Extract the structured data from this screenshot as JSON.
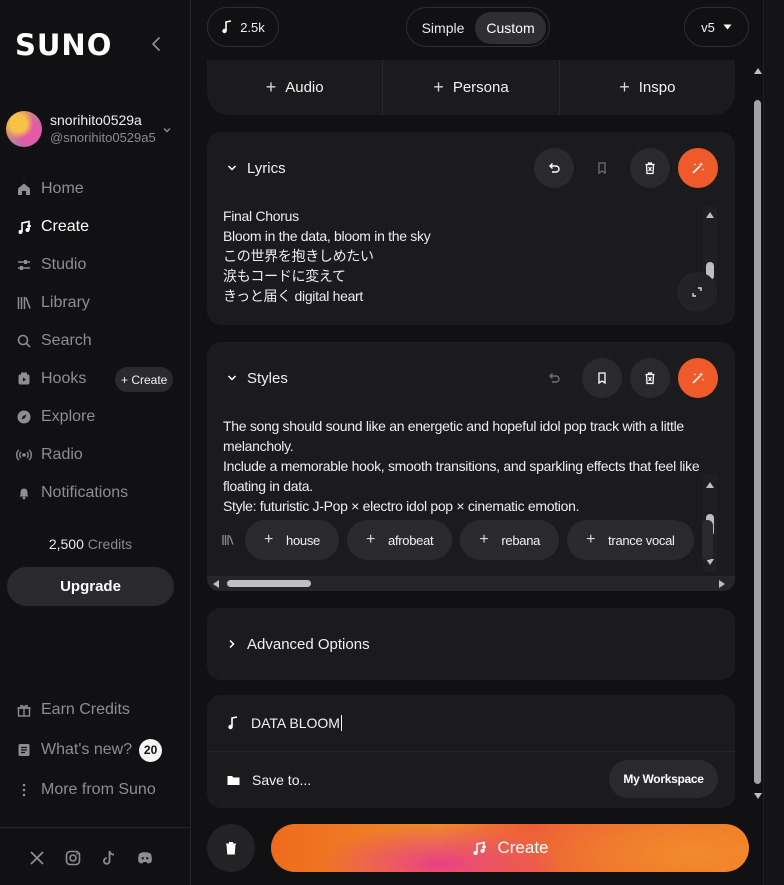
{
  "sidebar": {
    "logo": "SUNO",
    "user": {
      "name": "snorihito0529a",
      "handle": "@snorihito0529a5"
    },
    "nav": [
      {
        "label": "Home",
        "icon": "home-icon"
      },
      {
        "label": "Create",
        "icon": "create-icon",
        "active": true
      },
      {
        "label": "Studio",
        "icon": "studio-icon"
      },
      {
        "label": "Library",
        "icon": "library-icon"
      },
      {
        "label": "Search",
        "icon": "search-icon"
      },
      {
        "label": "Hooks",
        "icon": "hooks-icon"
      },
      {
        "label": "Explore",
        "icon": "explore-icon"
      },
      {
        "label": "Radio",
        "icon": "radio-icon"
      },
      {
        "label": "Notifications",
        "icon": "bell-icon"
      }
    ],
    "hooks_create_label": "+ Create",
    "credits": {
      "amount": "2,500",
      "label": "Credits"
    },
    "upgrade_label": "Upgrade",
    "bottom": [
      {
        "label": "Earn Credits",
        "icon": "gift-icon"
      },
      {
        "label": "What's new?",
        "icon": "news-icon",
        "badge": "20"
      },
      {
        "label": "More from Suno",
        "icon": "more-icon"
      }
    ],
    "social": [
      "x-icon",
      "instagram-icon",
      "tiktok-icon",
      "discord-icon"
    ]
  },
  "topbar": {
    "count_label": "2.5k",
    "mode_simple": "Simple",
    "mode_custom": "Custom",
    "version_label": "v5"
  },
  "add_row": {
    "audio": "Audio",
    "persona": "Persona",
    "inspo": "Inspo"
  },
  "lyrics": {
    "title": "Lyrics",
    "lines": [
      "Final Chorus",
      "Bloom in the data, bloom in the sky",
      "この世界を抱きしめたい",
      "涙もコードに変えて",
      "きっと届く digital heart"
    ]
  },
  "styles": {
    "title": "Styles",
    "lines": [
      "The song should sound like an energetic and hopeful idol pop track with a little",
      "melancholy.",
      "Include a memorable hook, smooth transitions, and sparkling effects that feel like",
      "floating in data.",
      "Style: futuristic J-Pop × electro idol pop × cinematic emotion."
    ],
    "tags": [
      "house",
      "afrobeat",
      "rebana",
      "trance vocal"
    ]
  },
  "advanced_label": "Advanced Options",
  "song_title": "DATA BLOOM",
  "save_to_label": "Save to...",
  "workspace_label": "My Workspace",
  "create_label": "Create",
  "colors": {
    "accent": "#ef5a2a",
    "background": "#111113",
    "card": "#1b1b1e"
  }
}
